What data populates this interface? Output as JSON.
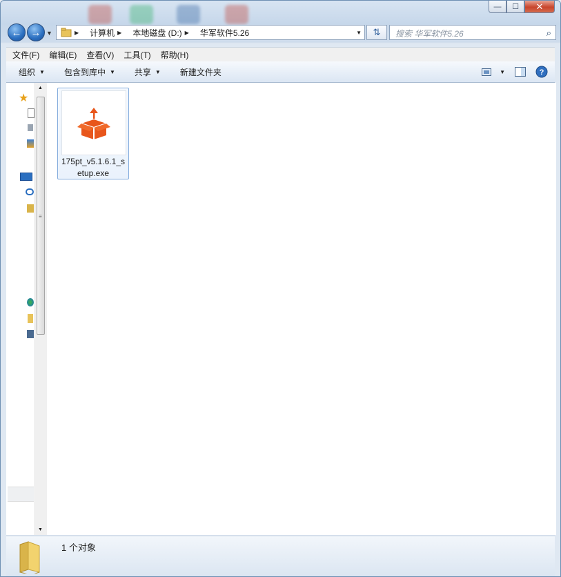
{
  "window": {
    "caption_buttons": {
      "minimize": "—",
      "maximize": "☐",
      "close": "✕"
    }
  },
  "nav": {
    "breadcrumbs": [
      "计算机",
      "本地磁盘 (D:)",
      "华军软件5.26"
    ],
    "search_placeholder": "搜索 华军软件5.26"
  },
  "menu": {
    "items": [
      "文件(F)",
      "编辑(E)",
      "查看(V)",
      "工具(T)",
      "帮助(H)"
    ]
  },
  "toolbar": {
    "organize": "组织",
    "include_in_library": "包含到库中",
    "share": "共享",
    "new_folder": "新建文件夹"
  },
  "files": [
    {
      "name": "175pt_v5.1.6.1_setup.exe",
      "icon": "orange-package-icon"
    }
  ],
  "status": {
    "count_text": "1 个对象"
  },
  "colors": {
    "accent": "#e8561b",
    "selection": "#84acdd"
  }
}
